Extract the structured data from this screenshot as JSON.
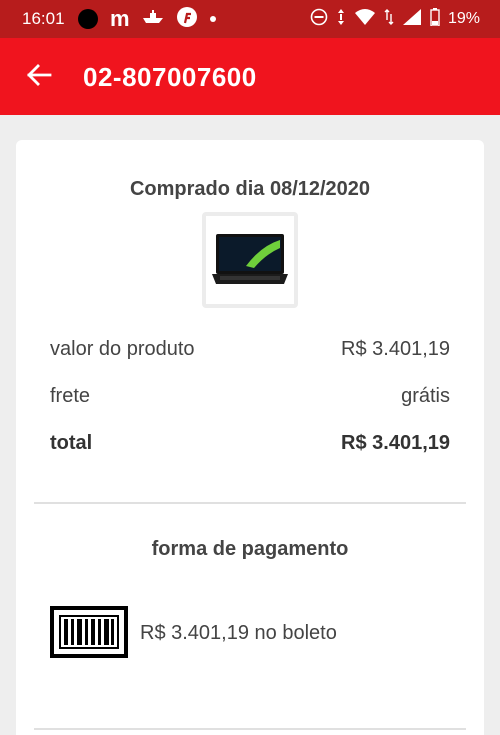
{
  "status_bar": {
    "time": "16:01",
    "battery": "19%",
    "icons": [
      "circle-icon",
      "m-app-icon",
      "boat-icon",
      "f-app-icon",
      "notification-dot-icon",
      "dnd-icon",
      "vibrate-icon",
      "wifi-icon",
      "signal-icon",
      "battery-icon"
    ]
  },
  "app_bar": {
    "title": "02-807007600",
    "back_icon": "arrow-back-icon",
    "background": "#f0141e"
  },
  "order": {
    "purchase_date": "Comprado dia 08/12/2020",
    "product_image": "laptop",
    "rows": [
      {
        "label": "valor do produto",
        "value": "R$ 3.401,19"
      },
      {
        "label": "frete",
        "value": "grátis"
      },
      {
        "label": "total",
        "value": "R$ 3.401,19"
      }
    ]
  },
  "payment": {
    "title": "forma de pagamento",
    "icon": "barcode-icon",
    "text": "R$ 3.401,19 no boleto"
  }
}
